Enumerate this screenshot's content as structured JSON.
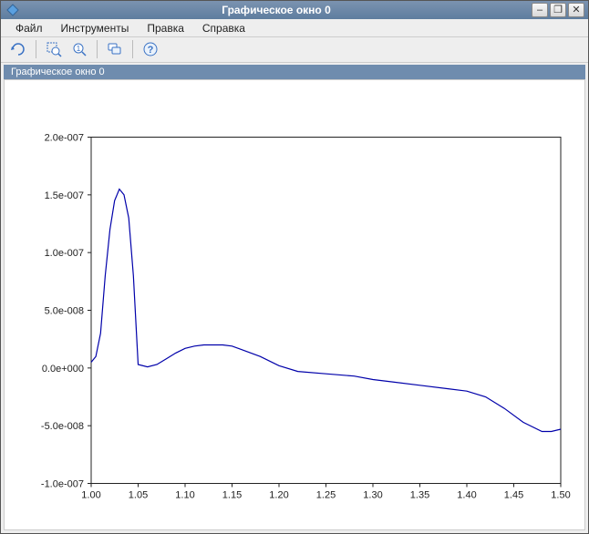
{
  "window": {
    "title": "Графическое окно 0",
    "minimize": "–",
    "maximize": "❐",
    "close": "✕"
  },
  "menu": {
    "file": "Файл",
    "tools": "Инструменты",
    "edit": "Правка",
    "help": "Справка"
  },
  "toolbar": {
    "rotate": "rotate-icon",
    "zoom_area": "zoom-area-icon",
    "zoom_reset": "zoom-reset-icon",
    "datatip": "datatip-icon",
    "help": "help-icon"
  },
  "inner_title": "Графическое окно 0",
  "chart_data": {
    "type": "line",
    "xlabel": "",
    "ylabel": "",
    "title": "",
    "xlim": [
      1.0,
      1.5
    ],
    "ylim": [
      -1e-07,
      2e-07
    ],
    "x_ticks": [
      "1.00",
      "1.05",
      "1.10",
      "1.15",
      "1.20",
      "1.25",
      "1.30",
      "1.35",
      "1.40",
      "1.45",
      "1.50"
    ],
    "y_ticks": [
      "-1.0e-007",
      "-5.0e-008",
      "0.0e+000",
      "5.0e-008",
      "1.0e-007",
      "1.5e-007",
      "2.0e-007"
    ],
    "x": [
      1.0,
      1.005,
      1.01,
      1.015,
      1.02,
      1.025,
      1.03,
      1.035,
      1.04,
      1.045,
      1.05,
      1.06,
      1.07,
      1.08,
      1.09,
      1.1,
      1.11,
      1.12,
      1.13,
      1.14,
      1.15,
      1.16,
      1.18,
      1.2,
      1.22,
      1.25,
      1.28,
      1.3,
      1.32,
      1.35,
      1.38,
      1.4,
      1.42,
      1.44,
      1.46,
      1.48,
      1.49,
      1.5
    ],
    "y": [
      5e-09,
      1e-08,
      3e-08,
      8e-08,
      1.2e-07,
      1.45e-07,
      1.55e-07,
      1.5e-07,
      1.3e-07,
      8e-08,
      3e-09,
      1e-09,
      3e-09,
      8e-09,
      1.3e-08,
      1.7e-08,
      1.9e-08,
      2e-08,
      2e-08,
      2e-08,
      1.9e-08,
      1.6e-08,
      1e-08,
      2e-09,
      -3e-09,
      -5e-09,
      -7e-09,
      -1e-08,
      -1.2e-08,
      -1.5e-08,
      -1.8e-08,
      -2e-08,
      -2.5e-08,
      -3.5e-08,
      -4.7e-08,
      -5.5e-08,
      -5.5e-08,
      -5.3e-08
    ]
  }
}
